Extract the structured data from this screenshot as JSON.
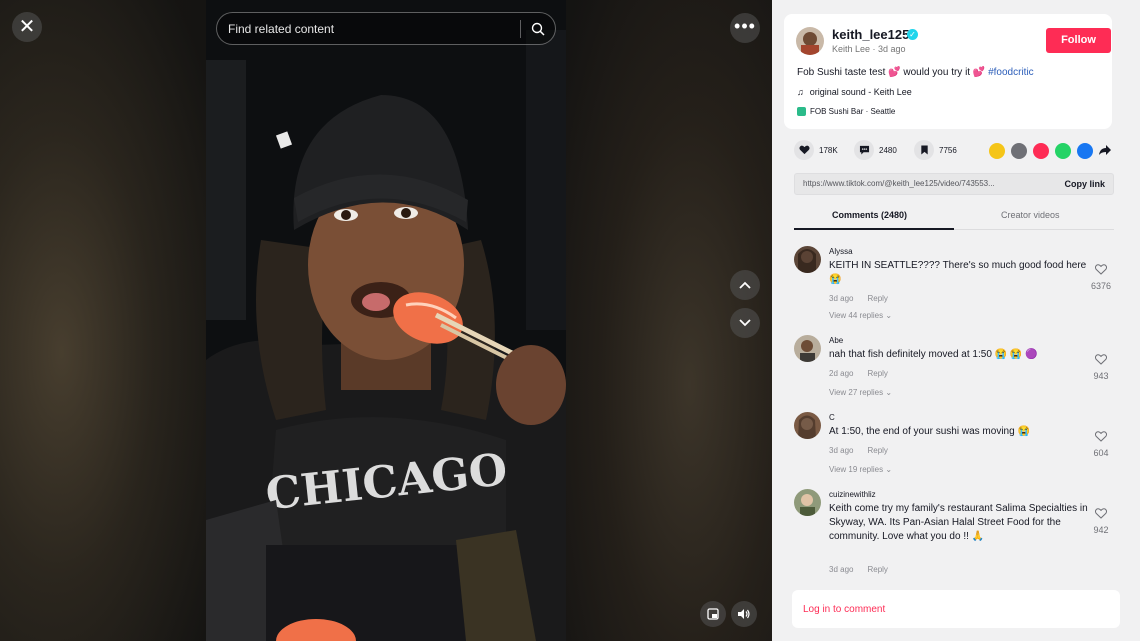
{
  "video": {
    "search_placeholder": "Find related content"
  },
  "author": {
    "username": "keith_lee125",
    "display_name": "Keith Lee",
    "posted": "3d ago",
    "follow_label": "Follow",
    "description": "Fob Sushi taste test 💕 would you try it 💕",
    "hashtag": "#foodcritic",
    "sound": "original sound - Keith Lee",
    "location": "FOB Sushi Bar · Seattle"
  },
  "stats": {
    "likes": "178K",
    "comments": "2480",
    "saves": "7756"
  },
  "share_colors": [
    "#f5c518",
    "#6f7076",
    "#fe2c55",
    "#25d366",
    "#1877f2"
  ],
  "link": {
    "url": "https://www.tiktok.com/@keith_lee125/video/743553...",
    "copy_label": "Copy link"
  },
  "tabs": {
    "comments": "Comments (2480)",
    "creator_videos": "Creator videos"
  },
  "comments": [
    {
      "user": "Alyssa",
      "text": "KEITH IN SEATTLE???? There's so much good food here 😭",
      "time": "3d ago",
      "reply": "Reply",
      "replies": "View 44 replies",
      "likes": "6376"
    },
    {
      "user": "Abe",
      "text": "nah that fish definitely moved at 1:50 😭 😭 🟣",
      "time": "2d ago",
      "reply": "Reply",
      "replies": "View 27 replies",
      "likes": "943"
    },
    {
      "user": "C",
      "text": "At 1:50, the end of your sushi was moving 😭",
      "time": "3d ago",
      "reply": "Reply",
      "replies": "View 19 replies",
      "likes": "604"
    },
    {
      "user": "cuizinewithliz",
      "text": "Keith come try my family's restaurant Salima Specialties in Skyway, WA. Its Pan-Asian Halal Street Food for the community. Love what you do !! 🙏",
      "time": "3d ago",
      "reply": "Reply",
      "likes": "942"
    }
  ],
  "login_label": "Log in to comment",
  "icons": [
    "close-icon",
    "more-icon",
    "search-icon",
    "chevron-up-icon",
    "chevron-down-icon",
    "pip-icon",
    "volume-icon",
    "heart-icon",
    "comment-icon",
    "bookmark-icon",
    "music-note-icon",
    "share-arrow-icon"
  ]
}
